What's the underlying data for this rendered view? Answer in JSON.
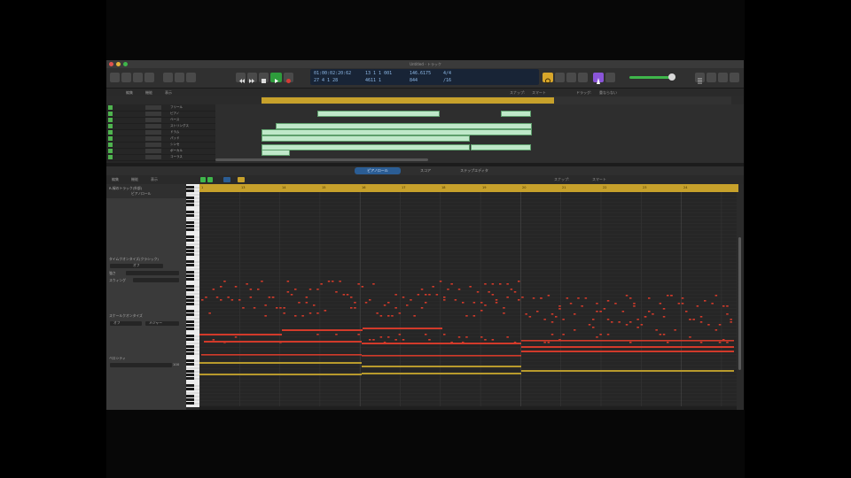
{
  "window": {
    "title": "Untitled - トラック"
  },
  "lcd": {
    "position_time": "01:00:02:20:62",
    "bar_position": "13  1  1  001",
    "tempo": "146.6175",
    "signature": "4/4",
    "line2_a": "27  4  1  28",
    "line2_b": "4611  1",
    "line2_c": "844",
    "line2_d": "/16"
  },
  "arrange_toolbar": {
    "edit": "編集",
    "functions": "機能",
    "view": "表示",
    "snap": "スナップ:",
    "snap_value": "スマート",
    "drag": "ドラッグ:",
    "drag_value": "重ならない"
  },
  "tracks": [
    {
      "name": "フリール"
    },
    {
      "name": "ピアノ"
    },
    {
      "name": "ベース"
    },
    {
      "name": "ストリングス"
    },
    {
      "name": "ドラム"
    },
    {
      "name": "パッド"
    },
    {
      "name": "シンセ"
    },
    {
      "name": "ボーカル"
    },
    {
      "name": "コーラス"
    }
  ],
  "editor_tabs": {
    "piano_roll": "ピアノロール",
    "score": "スコア",
    "step_editor": "ステップエディタ"
  },
  "editor_toolbar": {
    "edit": "編集",
    "functions": "機能",
    "view": "表示",
    "snap": "スナップ:",
    "snap_value": "スマート"
  },
  "inspector": {
    "region_name": "R-緑のトラック(外部)",
    "region_sub": "ピアノロール",
    "time_quantize": "タイムクオンタイズ(クラシック)",
    "quantize_value": "オフ",
    "strength": "強さ",
    "swing": "スウィング",
    "scale_quantize": "スケールクオンタイズ",
    "scale_value": "オフ",
    "major": "メジャー",
    "velocity": "ベロシティ",
    "velocity_value": "100"
  },
  "ruler_marks": [
    "1",
    "13",
    "14",
    "15",
    "16",
    "17",
    "18",
    "19",
    "20",
    "21",
    "22",
    "23",
    "24"
  ],
  "colors": {
    "region_green": "#bfe8c9",
    "cycle_yellow": "#c7a12b",
    "note_red": "#d23a2a",
    "note_amber": "#b89a2c",
    "lcd_blue": "#8db8e6",
    "play_green": "#2e9c3c"
  },
  "icons": [
    "rewind-icon",
    "forward-icon",
    "stop-icon",
    "play-icon",
    "record-icon",
    "cycle-icon",
    "metronome-icon",
    "list-icon"
  ]
}
